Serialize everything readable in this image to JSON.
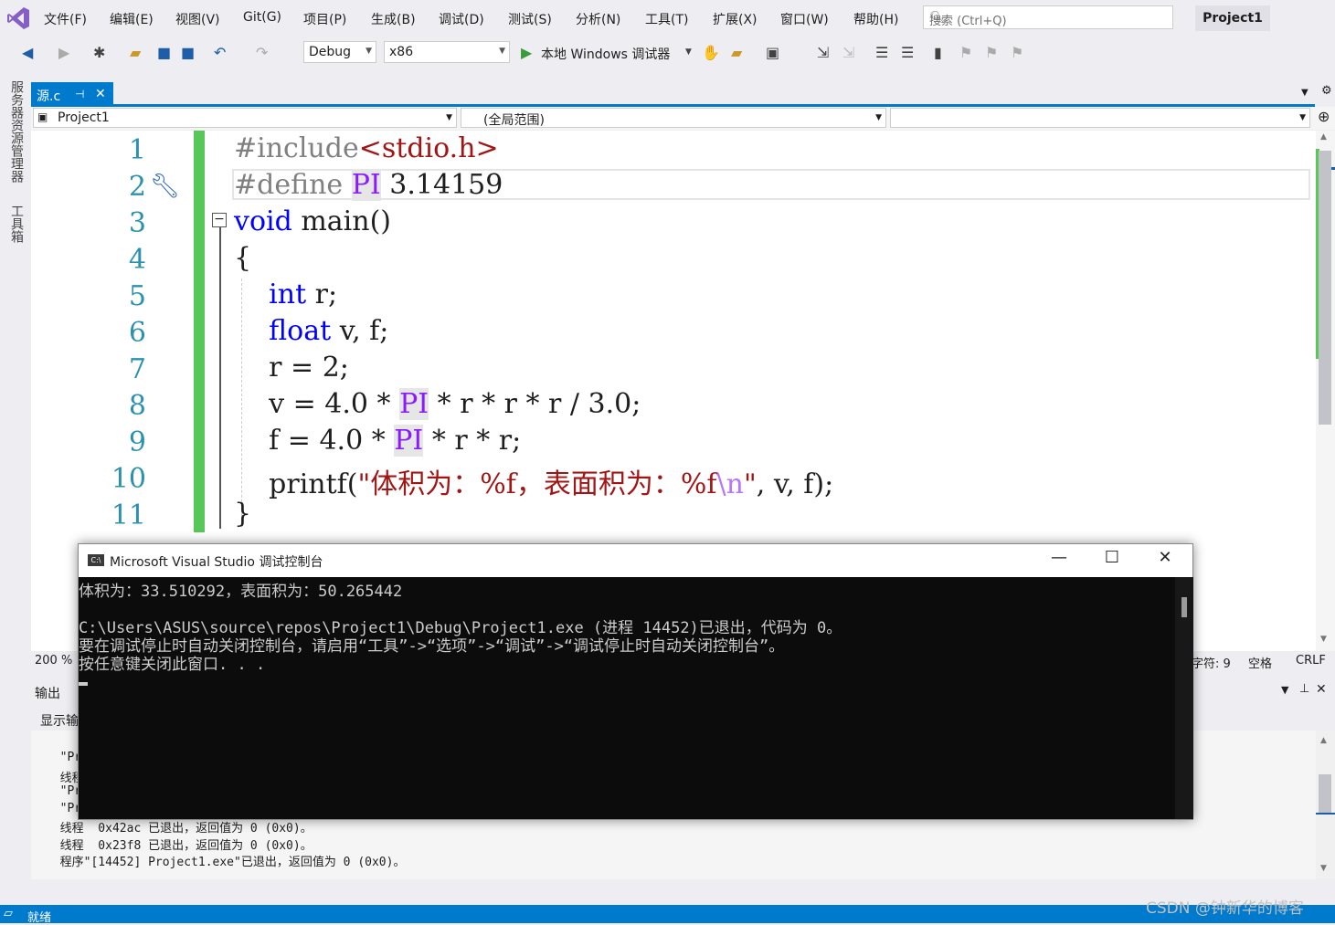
{
  "menu": {
    "items": [
      "文件(F)",
      "编辑(E)",
      "视图(V)",
      "Git(G)",
      "项目(P)",
      "生成(B)",
      "调试(D)",
      "测试(S)",
      "分析(N)",
      "工具(T)",
      "扩展(X)",
      "窗口(W)",
      "帮助(H)"
    ],
    "search_placeholder": "搜索 (Ctrl+Q)",
    "project_name": "Project1"
  },
  "toolbar": {
    "config": "Debug",
    "platform": "x86",
    "run_label": "本地 Windows 调试器"
  },
  "left_rail": {
    "server_explorer": "服务器资源管理器",
    "toolbox": "工具箱"
  },
  "tab": {
    "filename": "源.c",
    "pin": "⊣",
    "close": "✕"
  },
  "navbar": {
    "project": "Project1",
    "scope": "(全局范围)"
  },
  "editor": {
    "line_numbers": [
      "1",
      "2",
      "3",
      "4",
      "5",
      "6",
      "7",
      "8",
      "9",
      "10",
      "11"
    ]
  },
  "editor_status": {
    "zoom": "200 %",
    "char": "字符: 9",
    "space": "空格",
    "eol": "CRLF"
  },
  "output": {
    "title": "输出",
    "show_from": "显示输",
    "lines": [
      "  \"Pr",
      "  线程",
      "  \"Pr",
      "  \"Pr",
      "  线程  0x42ac 已退出，返回值为 0 (0x0)。",
      "  线程  0x23f8 已退出，返回值为 0 (0x0)。",
      "  程序\"[14452] Project1.exe\"已退出，返回值为 0 (0x0)。"
    ]
  },
  "statusbar": {
    "text": "就绪"
  },
  "console": {
    "title": "Microsoft Visual Studio 调试控制台",
    "lines": [
      "体积为：33.510292，表面积为：50.265442",
      "",
      "C:\\Users\\ASUS\\source\\repos\\Project1\\Debug\\Project1.exe (进程 14452)已退出，代码为 0。",
      "要在调试停止时自动关闭控制台，请启用“工具”->“选项”->“调试”->“调试停止时自动关闭控制台”。",
      "按任意键关闭此窗口. . ."
    ],
    "minimize": "—",
    "maximize": "☐",
    "close": "✕"
  },
  "watermark": "CSDN @钟新华的博客"
}
